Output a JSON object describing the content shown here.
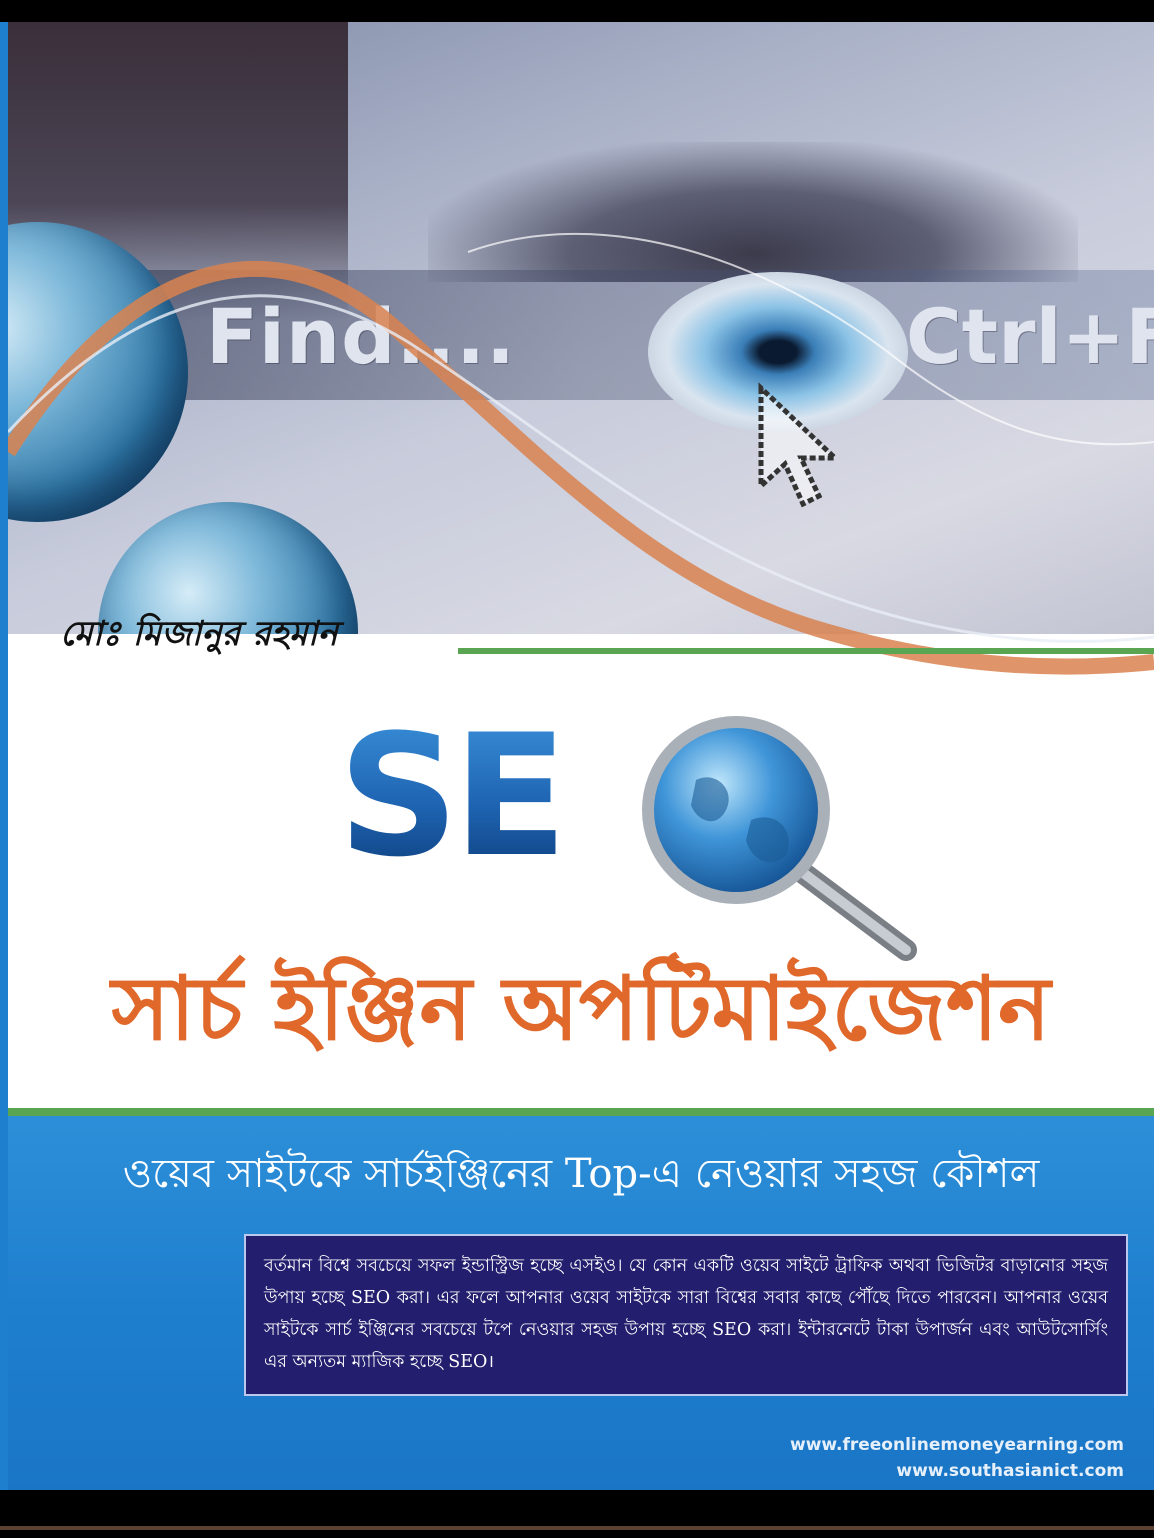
{
  "hero": {
    "find_text": "Find....",
    "shortcut_text": "Ctrl+F"
  },
  "author": "মোঃ মিজানুর রহমান",
  "logo_text": "SE",
  "title_bn": "সার্চ ইঞ্জিন অপটিমাইজেশন",
  "subtitle": "ওয়েব সাইটকে সার্চইঞ্জিনের Top-এ নেওয়ার সহজ কৌশল",
  "description": "বর্তমান বিশ্বে সবচেয়ে সফল ইন্ডাস্ট্রিজ হচ্ছে এসইও। যে কোন একটি ওয়েব সাইটে ট্রাফিক অথবা ভিজিটর বাড়ানোর সহজ উপায় হচ্ছে SEO করা। এর ফলে আপনার ওয়েব সাইটকে সারা বিশ্বের সবার কাছে পৌঁছে দিতে পারবেন। আপনার ওয়েব সাইটকে সার্চ ইঞ্জিনের সবচেয়ে টপে নেওয়ার সহজ উপায় হচ্ছে SEO করা। ইন্টারনেটে টাকা উপার্জন এবং আউটসোর্সিং এর অন্যতম ম্যাজিক হচ্ছে SEO।",
  "urls": [
    "www.freeonlinemoneyearning.com",
    "www.southasianict.com"
  ],
  "colors": {
    "title_orange": "#e0682a",
    "logo_blue": "#1d5fae",
    "panel_blue": "#1f7fcf",
    "box_navy": "#231e6e",
    "accent_green": "#5aa552"
  }
}
